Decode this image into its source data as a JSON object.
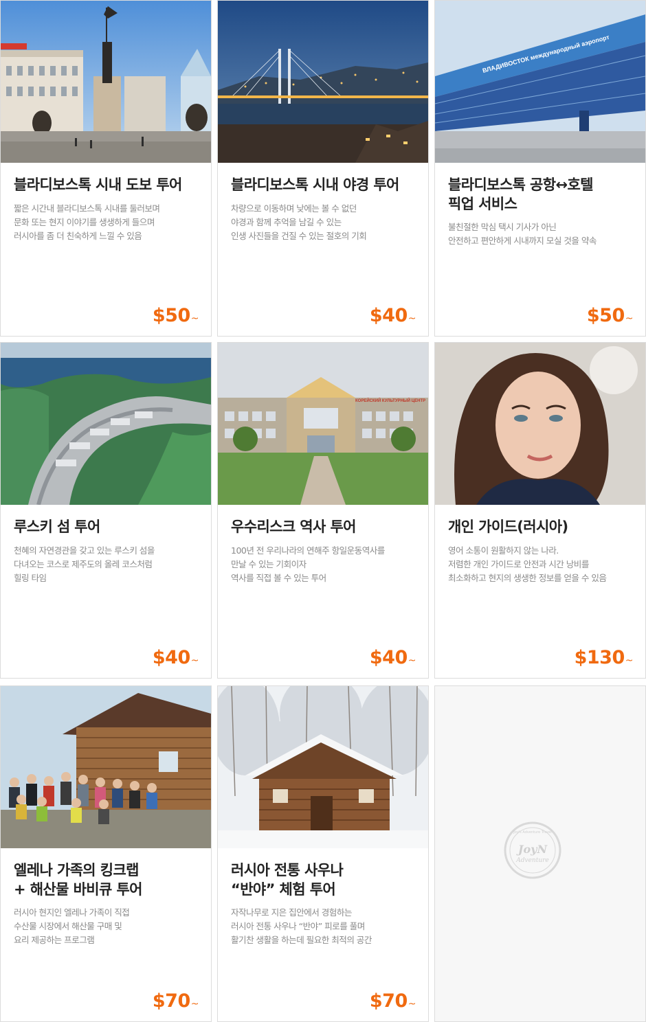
{
  "colors": {
    "price": "#f06a10",
    "title": "#222222",
    "desc": "#8a8a8a",
    "border": "#dcdcdc"
  },
  "tours": [
    {
      "title": "블라디보스톡 시내 도보 투어",
      "desc": "짧은 시간내 블라디보스톡 시내를 둘러보며\n문화 또는 현지 이야기를 생생하게 들으며\n러시아를 좀 더 친숙하게 느낄 수 있음",
      "price": "$50",
      "price_suffix": "~",
      "image": "monument-square-photo"
    },
    {
      "title": "블라디보스톡 시내 야경 투어",
      "desc": "차량으로 이동하며 낮에는 볼 수 없던\n야경과 함께 추억을 남길 수 있는\n인생 사진들을 건질 수 있는 절호의 기회",
      "price": "$40",
      "price_suffix": "~",
      "image": "night-bridge-photo"
    },
    {
      "title": "블라디보스톡 공항↔호텔\n픽업 서비스",
      "desc": "불친절한 막심 택시 기사가 아닌\n안전하고 편안하게 시내까지 모실 것을 약속",
      "price": "$50",
      "price_suffix": "~",
      "image": "airport-photo",
      "airport_sign": "ВЛАДИВОСТОК международный аэропорт"
    },
    {
      "title": "루스키 섬 투어",
      "desc": "천혜의 자연경관을 갖고 있는 루스키 섬을\n다녀오는 코스로 제주도의 올레 코스처럼\n힐링 타임",
      "price": "$40",
      "price_suffix": "~",
      "image": "island-aerial-photo"
    },
    {
      "title": "우수리스크 역사 투어",
      "desc": "100년 전 우리나라의 연해주 항일운동역사를\n만날 수 있는 기회이자\n역사를 직접 볼 수 있는 투어",
      "price": "$40",
      "price_suffix": "~",
      "image": "cultural-center-photo",
      "building_sign": "КОРЕЙСКИЙ КУЛЬТУРНЫЙ ЦЕНТР"
    },
    {
      "title": "개인 가이드(러시아)",
      "desc": "영어 소통이 원활하지 않는 나라.\n저렴한 개인 가이드로 안전과 시간 낭비를\n최소화하고 현지의 생생한 정보를 얻을 수 있음",
      "price": "$130",
      "price_suffix": "~",
      "image": "guide-portrait-photo"
    },
    {
      "title": "엘레나 가족의 킹크랩\n+ 해산물 바비큐 투어",
      "desc": "러시아 현지인 엘레나 가족이 직접\n수산물 시장에서 해산물 구매 및\n요리 제공하는 프로그램",
      "price": "$70",
      "price_suffix": "~",
      "image": "group-log-cabin-photo"
    },
    {
      "title": "러시아 전통 사우나\n“반야” 체험 투어",
      "desc": "자작나무로 지은 집안에서 경험하는\n러시아 전통 사우나 “반야” 피로를 풀며\n활기찬 생활을 하는데 필요한 최적의 공간",
      "price": "$70",
      "price_suffix": "~",
      "image": "snowy-sauna-cabin-photo"
    }
  ],
  "placeholder": {
    "logo_text_top": "Joy's Adventure Travel",
    "logo_text_main": "JoyN",
    "logo_text_sub": "Adventure"
  }
}
